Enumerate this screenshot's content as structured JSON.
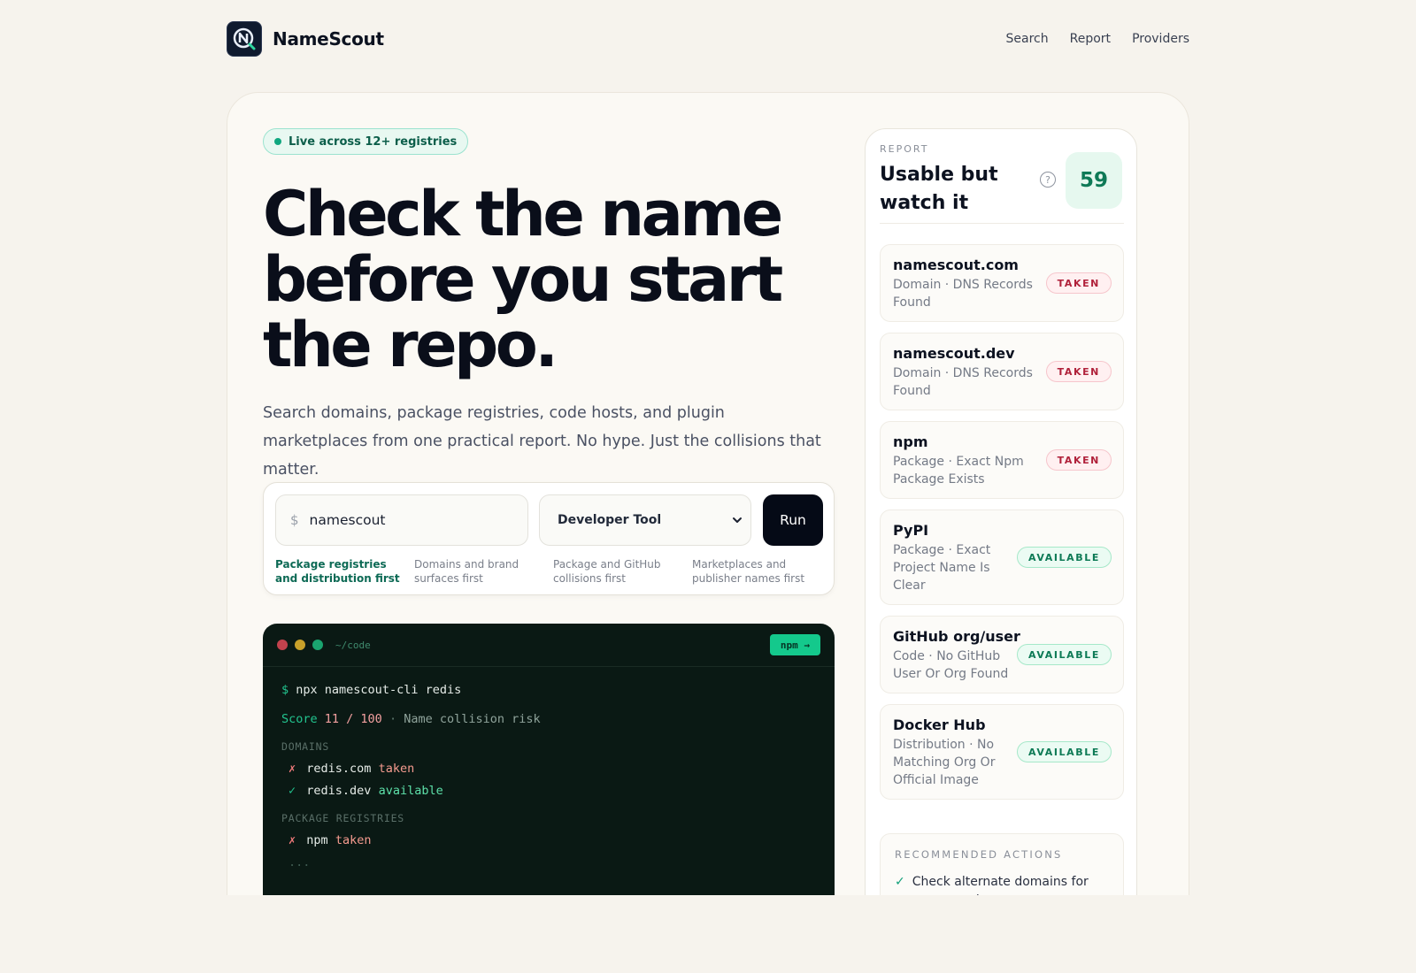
{
  "header": {
    "brand": "NameScout",
    "nav": [
      "Search",
      "Report",
      "Providers"
    ]
  },
  "hero": {
    "pill": "Live across 12+ registries",
    "headline": "Check the name before you start the repo.",
    "lede": "Search domains, package registries, code hosts, and plugin marketplaces from one practical report. No hype. Just the collisions that matter."
  },
  "search": {
    "prefix": "$",
    "value": "namescout",
    "category": "Developer Tool",
    "run_label": "Run",
    "modes": [
      "Package registries and distribution first",
      "Domains and brand surfaces first",
      "Package and GitHub collisions first",
      "Marketplaces and publisher names first"
    ]
  },
  "terminal": {
    "path": "~/code",
    "badge": "npm →",
    "command": "npx namescout-cli redis",
    "score_label": "Score",
    "score_value": "11 / 100",
    "score_sep": "·",
    "score_note": "Name collision risk",
    "section_domains": "DOMAINS",
    "domains": [
      {
        "mark": "✗",
        "name": "redis.com",
        "status": "taken"
      },
      {
        "mark": "✓",
        "name": "redis.dev",
        "status": "available"
      }
    ],
    "section_packages": "PACKAGE REGISTRIES",
    "packages": [
      {
        "mark": "✗",
        "name": "npm",
        "status": "taken"
      }
    ],
    "ellipsis": "..."
  },
  "report": {
    "eyebrow": "REPORT",
    "title": "Usable but watch it",
    "help": "?",
    "score": "59",
    "results": [
      {
        "name": "namescout.com",
        "meta": "Domain · DNS Records Found",
        "status": "TAKEN"
      },
      {
        "name": "namescout.dev",
        "meta": "Domain · DNS Records Found",
        "status": "TAKEN"
      },
      {
        "name": "npm",
        "meta": "Package · Exact Npm Package Exists",
        "status": "TAKEN"
      },
      {
        "name": "PyPI",
        "meta": "Package · Exact Project Name Is Clear",
        "status": "AVAILABLE"
      },
      {
        "name": "GitHub org/user",
        "meta": "Code · No GitHub User Or Org Found",
        "status": "AVAILABLE"
      },
      {
        "name": "Docker Hub",
        "meta": "Distribution · No Matching Org Or Official Image",
        "status": "AVAILABLE"
      }
    ],
    "actions_title": "RECOMMENDED ACTIONS",
    "actions": [
      "Check alternate domains for namescout"
    ]
  }
}
